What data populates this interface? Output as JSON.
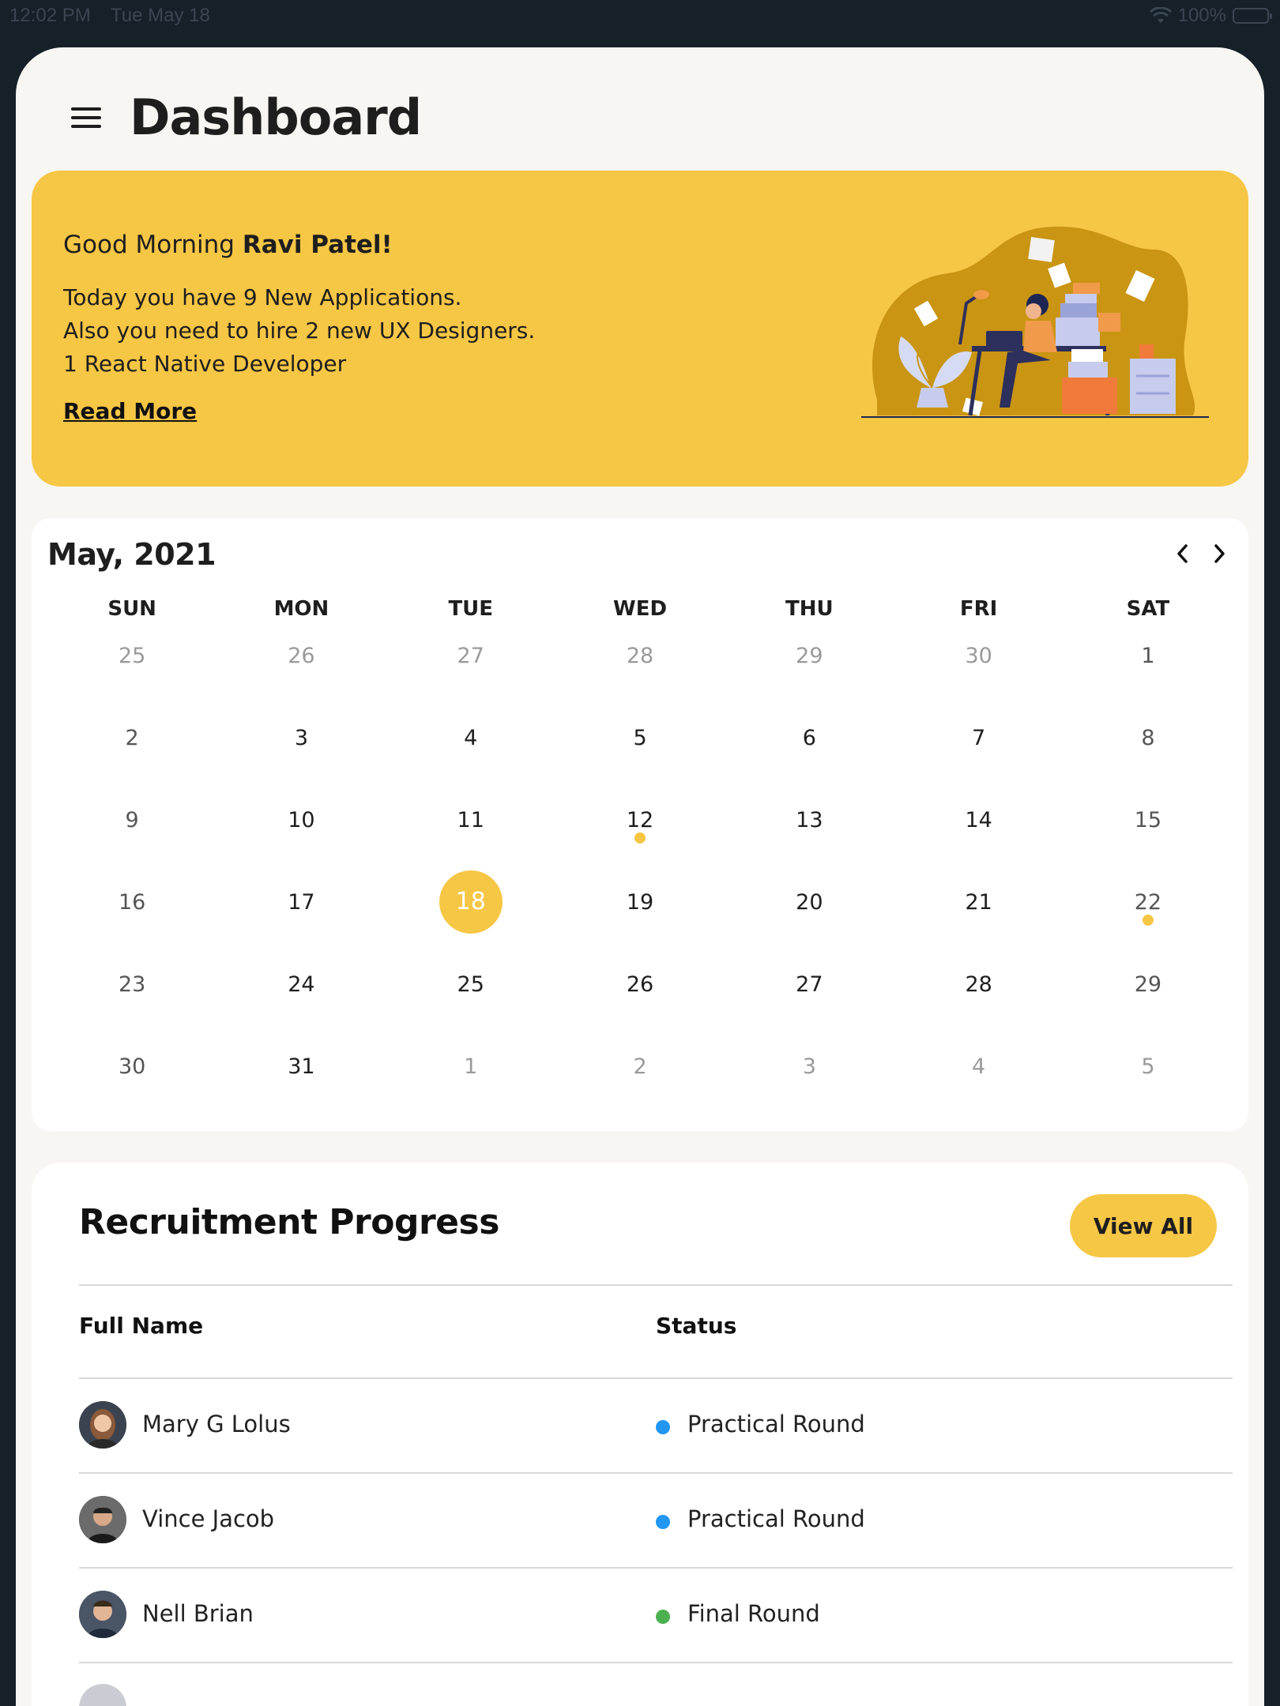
{
  "status_bar": {
    "time": "12:02 PM",
    "date": "Tue May 18",
    "battery": "100%"
  },
  "header": {
    "title": "Dashboard",
    "menu_icon": "hamburger-menu-icon"
  },
  "banner": {
    "greeting_prefix": "Good Morning ",
    "greeting_name": "Ravi Patel!",
    "line1": "Today you have 9 New Applications.",
    "line2": "Also you need to hire 2 new UX Designers. 1 React Native Developer",
    "read_more": "Read More",
    "background_color": "#f6c645"
  },
  "calendar": {
    "month_label": "May, 2021",
    "weekdays": [
      "SUN",
      "MON",
      "TUE",
      "WED",
      "THU",
      "FRI",
      "SAT"
    ],
    "days": [
      {
        "d": "25",
        "muted": true
      },
      {
        "d": "26",
        "muted": true
      },
      {
        "d": "27",
        "muted": true
      },
      {
        "d": "28",
        "muted": true
      },
      {
        "d": "29",
        "muted": true
      },
      {
        "d": "30",
        "muted": true
      },
      {
        "d": "1"
      },
      {
        "d": "2"
      },
      {
        "d": "3"
      },
      {
        "d": "4"
      },
      {
        "d": "5"
      },
      {
        "d": "6"
      },
      {
        "d": "7"
      },
      {
        "d": "8"
      },
      {
        "d": "9"
      },
      {
        "d": "10"
      },
      {
        "d": "11"
      },
      {
        "d": "12",
        "event": true
      },
      {
        "d": "13"
      },
      {
        "d": "14"
      },
      {
        "d": "15"
      },
      {
        "d": "16"
      },
      {
        "d": "17"
      },
      {
        "d": "18",
        "today": true
      },
      {
        "d": "19"
      },
      {
        "d": "20"
      },
      {
        "d": "21"
      },
      {
        "d": "22",
        "event": true
      },
      {
        "d": "23"
      },
      {
        "d": "24"
      },
      {
        "d": "25"
      },
      {
        "d": "26"
      },
      {
        "d": "27"
      },
      {
        "d": "28"
      },
      {
        "d": "29"
      },
      {
        "d": "30"
      },
      {
        "d": "31"
      },
      {
        "d": "1",
        "muted": true
      },
      {
        "d": "2",
        "muted": true
      },
      {
        "d": "3",
        "muted": true
      },
      {
        "d": "4",
        "muted": true
      },
      {
        "d": "5",
        "muted": true
      }
    ],
    "accent_color": "#f6c645"
  },
  "recruitment": {
    "title": "Recruitment Progress",
    "view_all": "View All",
    "columns": {
      "name": "Full Name",
      "status": "Status"
    },
    "rows": [
      {
        "name": "Mary G Lolus",
        "status": "Practical Round",
        "status_color": "#2196f3"
      },
      {
        "name": "Vince Jacob",
        "status": "Practical Round",
        "status_color": "#2196f3"
      },
      {
        "name": "Nell Brian",
        "status": "Final Round",
        "status_color": "#4caf50"
      }
    ]
  }
}
